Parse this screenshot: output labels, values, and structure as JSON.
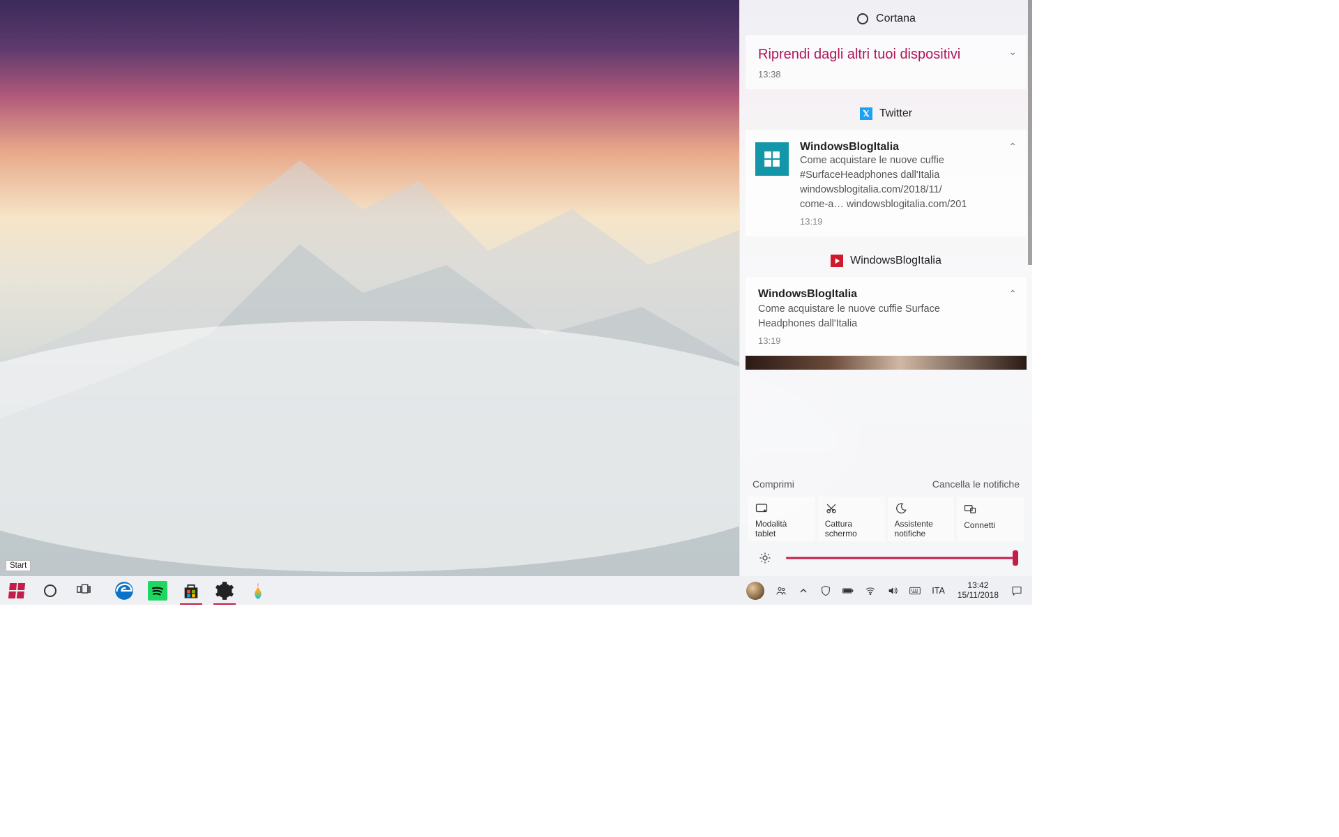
{
  "tooltip": {
    "start": "Start"
  },
  "action_center": {
    "groups": {
      "cortana": {
        "label": "Cortana"
      },
      "twitter": {
        "label": "Twitter"
      },
      "wbi": {
        "label": "WindowsBlogItalia"
      }
    },
    "cortana_card": {
      "title": "Riprendi dagli altri tuoi dispositivi",
      "time": "13:38"
    },
    "tweet": {
      "sender": "WindowsBlogItalia",
      "line1": "Come acquistare le nuove cuffie",
      "line2": "#SurfaceHeadphones dall'Italia",
      "line3": "windowsblogitalia.com/2018/11/",
      "line4": "come-a… windowsblogitalia.com/201",
      "time": "13:19"
    },
    "wbi_card": {
      "sender": "WindowsBlogItalia",
      "line1": "Come acquistare le nuove cuffie Surface",
      "line2": "Headphones dall'Italia",
      "time": "13:19"
    },
    "footer": {
      "collapse": "Comprimi",
      "clear": "Cancella le notifiche"
    },
    "quick_actions": [
      {
        "label": "Modalità tablet"
      },
      {
        "label": "Cattura schermo"
      },
      {
        "label": "Assistente notifiche"
      },
      {
        "label": "Connetti"
      }
    ],
    "brightness": {
      "value": 98
    }
  },
  "taskbar": {
    "lang": "ITA",
    "time": "13:42",
    "date": "15/11/2018"
  }
}
